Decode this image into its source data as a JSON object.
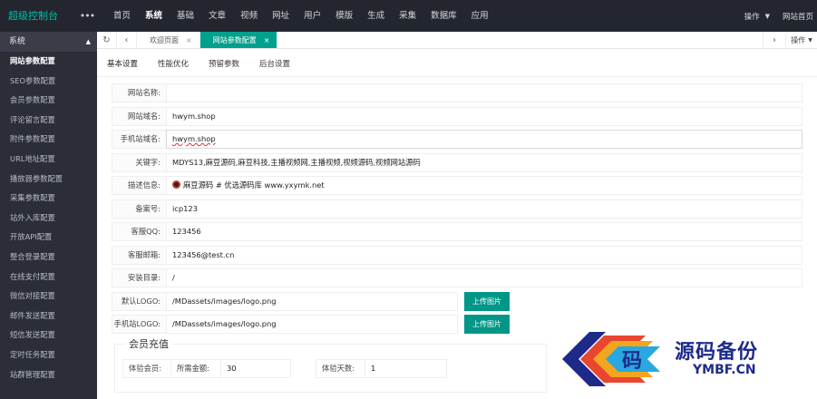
{
  "app": {
    "brand": "超级控制台",
    "menu_dots": "•••"
  },
  "topnav": {
    "items": [
      {
        "label": "首页"
      },
      {
        "label": "系统"
      },
      {
        "label": "基础"
      },
      {
        "label": "文章"
      },
      {
        "label": "视频"
      },
      {
        "label": "网址"
      },
      {
        "label": "用户"
      },
      {
        "label": "模版"
      },
      {
        "label": "生成"
      },
      {
        "label": "采集"
      },
      {
        "label": "数据库"
      },
      {
        "label": "应用"
      }
    ],
    "active": "系统",
    "operate_label": "操作",
    "home_label": "网站首页"
  },
  "sidebar": {
    "group_title": "系统",
    "items": [
      {
        "label": "网站参数配置"
      },
      {
        "label": "SEO参数配置"
      },
      {
        "label": "会员参数配置"
      },
      {
        "label": "评论留言配置"
      },
      {
        "label": "附件参数配置"
      },
      {
        "label": "URL地址配置"
      },
      {
        "label": "播放器参数配置"
      },
      {
        "label": "采集参数配置"
      },
      {
        "label": "站外入库配置"
      },
      {
        "label": "开放API配置"
      },
      {
        "label": "整合登录配置"
      },
      {
        "label": "在线支付配置"
      },
      {
        "label": "微信对接配置"
      },
      {
        "label": "邮件发送配置"
      },
      {
        "label": "短信发送配置"
      },
      {
        "label": "定时任务配置"
      },
      {
        "label": "站群管理配置"
      }
    ],
    "active": "网站参数配置"
  },
  "page_tabs": {
    "items": [
      {
        "label": "欢迎页面"
      },
      {
        "label": "网站参数配置"
      }
    ],
    "active": "网站参数配置",
    "close_glyph": "×",
    "operate_label": "操作"
  },
  "sub_tabs": {
    "items": [
      {
        "label": "基本设置"
      },
      {
        "label": "性能优化"
      },
      {
        "label": "预留参数"
      },
      {
        "label": "后台设置"
      }
    ],
    "active": "基本设置"
  },
  "form": {
    "site_name": {
      "label": "网站名称:",
      "value": ""
    },
    "site_domain": {
      "label": "网站域名:",
      "value": "hwym.shop"
    },
    "mobile_domain": {
      "label": "手机站域名:",
      "value": "hwym.shop"
    },
    "keywords": {
      "label": "关键字:",
      "value": "MDYS13,麻豆源码,麻豆科技,主播视频网,主播视频,视频源码,视频网站源码"
    },
    "description": {
      "label": "描述信息:",
      "value": "麻豆源码 # 优选源码库  www.yxymk.net"
    },
    "icp": {
      "label": "备案号:",
      "value": "icp123"
    },
    "qq": {
      "label": "客服QQ:",
      "value": "123456"
    },
    "email": {
      "label": "客服邮箱:",
      "value": "123456@test.cn"
    },
    "install_dir": {
      "label": "安装目录:",
      "value": "/"
    },
    "logo": {
      "label": "默认LOGO:",
      "value": "/MDassets/images/logo.png",
      "button": "上传图片"
    },
    "mobile_logo": {
      "label": "手机站LOGO:",
      "value": "/MDassets/images/logo.png",
      "button": "上传图片"
    }
  },
  "vip": {
    "legend": "会员充值",
    "trial_member_label": "体验会员:",
    "amount_label": "所需金额:",
    "amount_value": "30",
    "days_label": "体验天数:",
    "days_value": "1"
  },
  "watermark": {
    "title": "源码备份",
    "domain": "YMBF.CN",
    "logo_char": "码"
  },
  "colors": {
    "topbar": "#23262e",
    "sidebar": "#2b2e37",
    "accent": "#009688",
    "brand": "#00c1a8"
  }
}
